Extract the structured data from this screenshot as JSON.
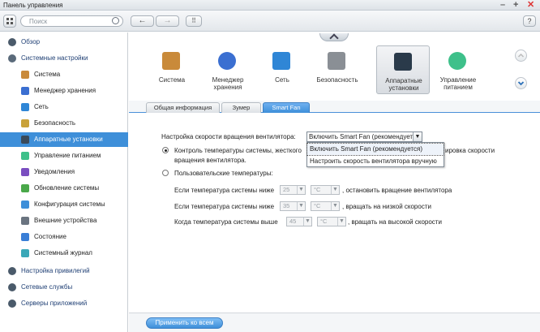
{
  "window": {
    "title": "Панель управления",
    "controls": [
      "–",
      "+",
      "✕"
    ]
  },
  "toolbar": {
    "search_placeholder": "Поиск",
    "help": "?"
  },
  "sidebar": {
    "items": [
      {
        "label": "Обзор",
        "level": "top",
        "icon": "overview-icon",
        "color": "#4a5a6a"
      },
      {
        "label": "Системные настройки",
        "level": "top",
        "icon": "gear-icon",
        "color": "#5a6a7a"
      },
      {
        "label": "Система",
        "level": "sub",
        "icon": "system-icon",
        "color": "#c98a3a"
      },
      {
        "label": "Менеджер хранения",
        "level": "sub",
        "icon": "storage-icon",
        "color": "#3b6fd1"
      },
      {
        "label": "Сеть",
        "level": "sub",
        "icon": "network-icon",
        "color": "#2f86d6"
      },
      {
        "label": "Безопасность",
        "level": "sub",
        "icon": "lock-icon",
        "color": "#c9a23a"
      },
      {
        "label": "Аппаратные установки",
        "level": "sub",
        "icon": "hardware-icon",
        "color": "#3a4a5a",
        "selected": true
      },
      {
        "label": "Управление питанием",
        "level": "sub",
        "icon": "bulb-icon",
        "color": "#3ec08a"
      },
      {
        "label": "Уведомления",
        "level": "sub",
        "icon": "notification-icon",
        "color": "#7a4ec0"
      },
      {
        "label": "Обновление системы",
        "level": "sub",
        "icon": "update-icon",
        "color": "#4aa84a"
      },
      {
        "label": "Конфигурация системы",
        "level": "sub",
        "icon": "config-icon",
        "color": "#3e8fd9"
      },
      {
        "label": "Внешние устройства",
        "level": "sub",
        "icon": "external-device-icon",
        "color": "#6a7480"
      },
      {
        "label": "Состояние",
        "level": "sub",
        "icon": "status-icon",
        "color": "#3a7ed6"
      },
      {
        "label": "Системный журнал",
        "level": "sub",
        "icon": "log-icon",
        "color": "#3aa8b8"
      },
      {
        "label": "Настройка привилегий",
        "level": "top",
        "icon": "user-icon",
        "color": "#4a5a6a"
      },
      {
        "label": "Сетевые службы",
        "level": "top",
        "icon": "globe-icon",
        "color": "#4a5a6a"
      },
      {
        "label": "Серверы приложений",
        "level": "top",
        "icon": "server-icon",
        "color": "#4a5a6a"
      }
    ]
  },
  "categories": [
    {
      "label": "Система",
      "icon": "system-icon",
      "color": "#c98a3a"
    },
    {
      "label": "Менеджер хранения",
      "icon": "storage-icon",
      "color": "#3b6fd1"
    },
    {
      "label": "Сеть",
      "icon": "network-icon",
      "color": "#2f86d6"
    },
    {
      "label": "Безопасность",
      "icon": "lock-icon",
      "color": "#8a8f95"
    },
    {
      "label": "Аппаратные установки",
      "icon": "hardware-icon",
      "color": "#2a3a4a",
      "active": true
    },
    {
      "label": "Управление питанием",
      "icon": "bulb-icon",
      "color": "#3ec08a"
    }
  ],
  "tabs": [
    "Общая информация",
    "Зумер",
    "Smart Fan"
  ],
  "active_tab": "Smart Fan",
  "fan": {
    "speed_label": "Настройка скорости вращения вентилятора:",
    "dropdown_value": "Включить Smart Fan (рекомендуется)",
    "dropdown_options": [
      "Включить Smart Fan (рекомендуется)",
      "Настроить скорость вентилятора вручную"
    ],
    "radio1_line1a": "Контроль температуры системы, жесткого",
    "radio1_line1b": "ировка скорости",
    "radio1_line2": "вращения вентилятора.",
    "radio2_label": "Пользовательские температуры:",
    "rules": [
      {
        "label": "Если температура системы ниже",
        "value": "25",
        "unit": "°C",
        "action": ", остановить вращение вентилятора"
      },
      {
        "label": "Если температура системы ниже",
        "value": "35",
        "unit": "°C",
        "action": ", вращать на низкой скорости"
      },
      {
        "label": "Когда температура системы выше",
        "value": "45",
        "unit": "°C",
        "action": ", вращать на высокой скорости"
      }
    ]
  },
  "footer": {
    "apply_label": "Применить ко всем"
  }
}
